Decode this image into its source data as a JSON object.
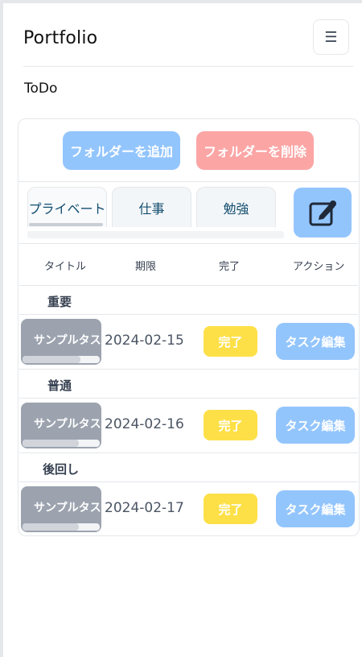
{
  "header": {
    "brand": "Portfolio",
    "menu_icon": "hamburger-icon",
    "menu_glyph": "☰"
  },
  "page": {
    "section_title": "ToDo"
  },
  "folder_actions": {
    "add_label": "フォルダーを追加",
    "delete_label": "フォルダーを削除"
  },
  "tabs": [
    {
      "label": "プライベート",
      "active": true
    },
    {
      "label": "仕事",
      "active": false
    },
    {
      "label": "勉強",
      "active": false
    }
  ],
  "edit_folder_icon": "edit-note-icon",
  "table": {
    "headers": {
      "title": "タイトル",
      "due": "期限",
      "done": "完了",
      "action": "アクション"
    },
    "groups": [
      {
        "label": "重要",
        "task": {
          "title": "サンプルタスク",
          "due": "2024-02-15",
          "done_label": "完了",
          "edit_label": "タスク編集",
          "progress": 0.75
        }
      },
      {
        "label": "普通",
        "task": {
          "title": "サンプルタスク",
          "due": "2024-02-16",
          "done_label": "完了",
          "edit_label": "タスク編集",
          "progress": 0.73
        }
      },
      {
        "label": "後回し",
        "task": {
          "title": "サンプルタスク",
          "due": "2024-02-17",
          "done_label": "完了",
          "edit_label": "タスク編集",
          "progress": 0.73
        }
      }
    ]
  },
  "colors": {
    "primary_light": "#93c5fd",
    "danger_light": "#fca5a5",
    "warning": "#fde047",
    "chip_gray": "#9ca3af"
  }
}
